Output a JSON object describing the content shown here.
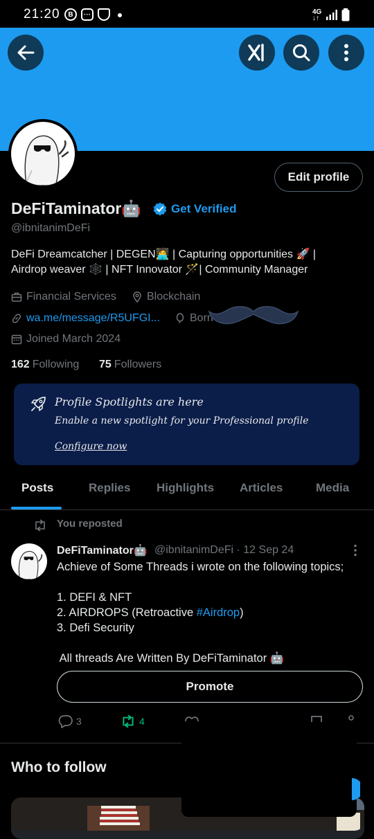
{
  "status_bar": {
    "time": "21:20",
    "network": "4G"
  },
  "header": {
    "back_icon": "arrow-left-icon",
    "grok_icon": "grok-icon",
    "search_icon": "search-icon",
    "more_icon": "more-vertical-icon"
  },
  "profile": {
    "name": "DeFiTaminator🤖",
    "get_verified": "Get Verified",
    "handle": "@ibnitanimDeFi",
    "bio_line1": "DeFi Dreamcatcher | DEGEN🧑‍💻 | Capturing opportunities 🚀 |",
    "bio_line2": "Airdrop weaver 🕸️ | NFT Innovator 🪄| Community Manager",
    "category": "Financial Services",
    "location": "Blockchain",
    "website": "wa.me/message/R5UFGI...",
    "born": "Born",
    "joined": "Joined March 2024",
    "following_count": "162",
    "following_label": "Following",
    "followers_count": "75",
    "followers_label": "Followers",
    "edit_profile": "Edit profile"
  },
  "spotlight": {
    "title": "Profile Spotlights are here",
    "subtitle": "Enable a new spotlight for your Professional profile",
    "link": "Configure now"
  },
  "tabs": [
    {
      "label": "Posts",
      "active": true
    },
    {
      "label": "Replies"
    },
    {
      "label": "Highlights"
    },
    {
      "label": "Articles"
    },
    {
      "label": "Media"
    }
  ],
  "post": {
    "repost_label": "You reposted",
    "author": "DeFiTaminator🤖",
    "meta": "@ibnitanimDeFi · 12 Sep 24",
    "text_line1": "Achieve of Some Threads i wrote on the following topics;",
    "list1": "1. DEFI & NFT",
    "list2_pre": "2. AIRDROPS (Retroactive ",
    "list2_tag": "#Airdrop",
    "list2_post": ")",
    "list3": "3. Defi Security",
    "closing": " All threads Are Written By DeFiTaminator 🤖",
    "promote": "Promote",
    "replies": "3",
    "reposts": "4"
  },
  "who_to_follow": {
    "title": "Who to follow"
  },
  "colors": {
    "banner": "#1d9bf0",
    "accent": "#1d9bf0",
    "repost_green": "#00ba7c",
    "spotlight_bg": "#0b1d49"
  }
}
